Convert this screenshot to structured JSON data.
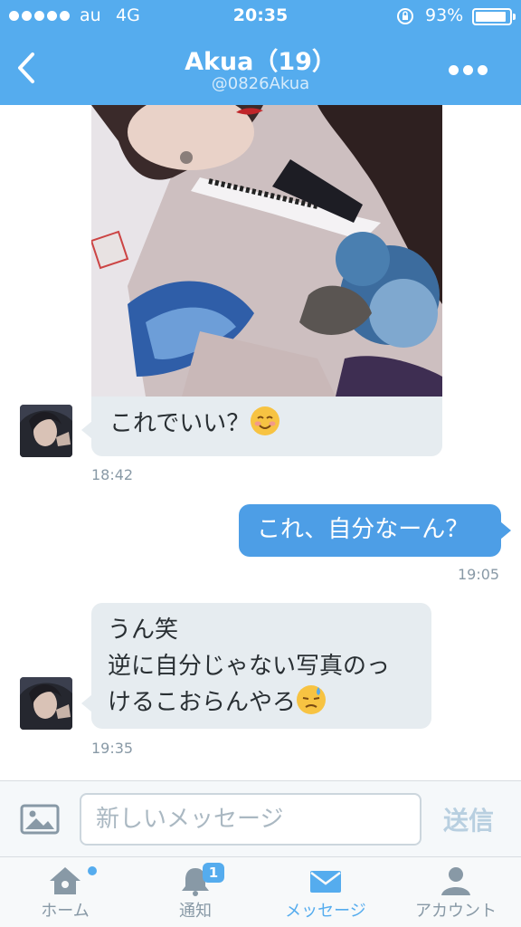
{
  "status_bar": {
    "carrier": "au",
    "network": "4G",
    "time": "20:35",
    "battery": "93%",
    "battery_level": 0.93
  },
  "header": {
    "title": "Akua（19）",
    "handle": "@0826Akua",
    "back_icon": "chevron-left-icon",
    "more_icon": "more-dots-icon"
  },
  "messages": [
    {
      "direction": "in",
      "has_photo": true,
      "text": "これでいい？",
      "emoji": "smiling-face-icon",
      "time": "18:42"
    },
    {
      "direction": "out",
      "text": "これ、自分なーん？",
      "time": "19:05"
    },
    {
      "direction": "in",
      "lines": [
        "うん笑",
        "逆に自分じゃない写真のっ",
        "けるこおらんやろ"
      ],
      "emoji": "sweat-face-icon",
      "time": "19:35"
    }
  ],
  "composer": {
    "placeholder": "新しいメッセージ",
    "send_label": "送信"
  },
  "tabs": [
    {
      "label": "ホーム",
      "icon": "home-icon",
      "active": false,
      "dot": true
    },
    {
      "label": "通知",
      "icon": "bell-icon",
      "active": false,
      "badge": "1"
    },
    {
      "label": "メッセージ",
      "icon": "envelope-icon",
      "active": true
    },
    {
      "label": "アカウント",
      "icon": "person-icon",
      "active": false
    }
  ],
  "colors": {
    "brand": "#55acee",
    "outgoing_bubble": "#4d9ee6",
    "incoming_bubble": "#e6ecf0",
    "timestamp": "#8899a6"
  }
}
